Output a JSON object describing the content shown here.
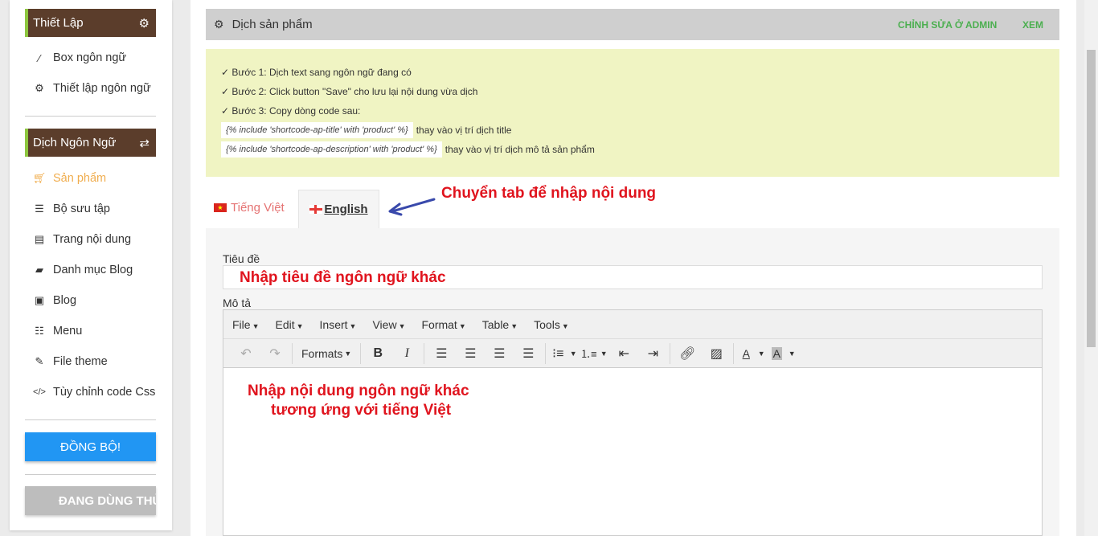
{
  "sidebar": {
    "section1": {
      "title": "Thiết Lập",
      "icon": "gear-icon"
    },
    "section1_items": [
      {
        "label": "Box ngôn ngữ",
        "icon": "magic-wand-icon"
      },
      {
        "label": "Thiết lập ngôn ngữ",
        "icon": "gear-icon"
      }
    ],
    "section2": {
      "title": "Dịch Ngôn Ngữ",
      "icon": "exchange-icon"
    },
    "section2_items": [
      {
        "label": "Sản phẩm",
        "icon": "cart-icon",
        "active": true
      },
      {
        "label": "Bộ sưu tập",
        "icon": "list-icon"
      },
      {
        "label": "Trang nội dung",
        "icon": "file-icon"
      },
      {
        "label": "Danh mục Blog",
        "icon": "book-icon"
      },
      {
        "label": "Blog",
        "icon": "newspaper-icon"
      },
      {
        "label": "Menu",
        "icon": "menu-list-icon"
      },
      {
        "label": "File theme",
        "icon": "edit-icon"
      },
      {
        "label": "Tùy chỉnh code Css",
        "icon": "code-icon"
      }
    ],
    "sync_button": "ĐỒNG BỘ!",
    "trial_button": "ĐANG DÙNG THỬ"
  },
  "header": {
    "title": "Dịch sản phẩm",
    "link_admin": "CHỈNH SỬA Ở ADMIN",
    "link_view": "XEM"
  },
  "info": {
    "step1": "✓ Bước 1: Dịch text sang ngôn ngữ đang có",
    "step2": "✓ Bước 2: Click button \"Save\" cho lưu lại nội dung vừa dịch",
    "step3": "✓ Bước 3: Copy dòng code sau:",
    "code1": "{% include 'shortcode-ap-title' with 'product' %}",
    "code1_note": "thay vào vị trí dịch title",
    "code2": "{% include 'shortcode-ap-description' with 'product' %}",
    "code2_note": "thay vào vị trí dịch mô tả sản phẩm"
  },
  "tabs": [
    {
      "label": "Tiếng Việt",
      "active": false
    },
    {
      "label": "English",
      "active": true
    }
  ],
  "annotations": {
    "tab_hint": "Chuyển tab để nhập nội dung",
    "title_hint": "Nhập tiêu đề ngôn ngữ khác",
    "content_hint_line1": "Nhập nội dung ngôn ngữ khác",
    "content_hint_line2": "tương ứng với tiếng Việt"
  },
  "form": {
    "title_label": "Tiêu đề",
    "title_value": "",
    "desc_label": "Mô tả"
  },
  "editor": {
    "menus": [
      "File",
      "Edit",
      "Insert",
      "View",
      "Format",
      "Table",
      "Tools"
    ],
    "formats_label": "Formats"
  },
  "colors": {
    "sidebar_header_bg": "#5b3d2b",
    "sidebar_header_accent": "#8dc63f",
    "active_item": "#f0ad4e",
    "sync_button": "#2196f3",
    "admin_link": "#4caf50",
    "info_bg": "#f0f4c3",
    "annotation": "#e0141e"
  }
}
